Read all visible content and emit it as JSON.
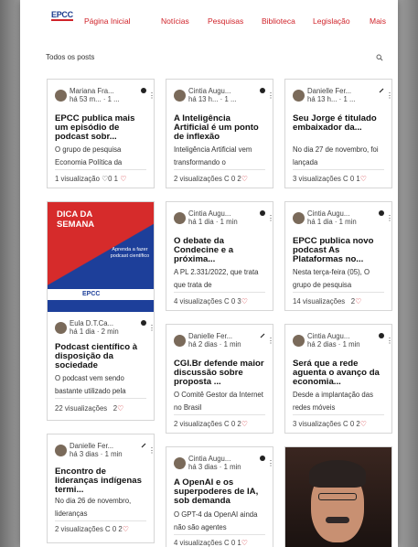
{
  "nav": {
    "logo": "EPCC",
    "items": [
      "Página Inicial",
      "Notícias",
      "Pesquisas",
      "Biblioteca",
      "Legislação",
      "Mais"
    ]
  },
  "section_title": "Todos os posts",
  "colors": {
    "accent": "#d0232a",
    "brand_blue": "#1d3d8f"
  },
  "posts": [
    {
      "author": "Mariana Fra...",
      "meta": "há 53 m... · 1 ...",
      "title": "EPCC publica mais um episódio de podcast sobr...",
      "excerpt": "O grupo de pesquisa Economia Política da",
      "views": "1 visualização",
      "comments": "0",
      "likes": "1"
    },
    {
      "author": "Cintia Augu...",
      "meta": "há 13 h... · 1 ...",
      "title": "A Inteligência Artificial é um ponto de inflexão",
      "excerpt": "Inteligência Artificial vem transformando o",
      "views": "2 visualizações",
      "comments": "0",
      "likes": "2"
    },
    {
      "author": "Danielle Fer...",
      "meta": "há 13 h... · 1 ...",
      "title": "Seu Jorge é titulado embaixador da...",
      "excerpt": "No dia 27 de novembro, foi lançada",
      "views": "3 visualizações",
      "comments": "0",
      "likes": "1"
    },
    {
      "promo_big": "DICA DA SEMANA",
      "promo_small": "Aprenda a fazer podcast científico",
      "promo_logo": "EPCC",
      "author": "Eula D.T.Ca...",
      "meta": "há 1 dia · 2 min",
      "title": "Podcast científico à disposição da sociedade",
      "excerpt": "O podcast vem sendo bastante utilizado pela",
      "views": "22 visualizações",
      "comments": "",
      "likes": "2"
    },
    {
      "author": "Cintia Augu...",
      "meta": "há 1 dia · 1 min",
      "title": "O debate da Condecine e a próxima...",
      "excerpt": "A PL 2.331/2022, que trata que trata de",
      "views": "4 visualizações",
      "comments": "0",
      "likes": "3"
    },
    {
      "author": "Cintia Augu...",
      "meta": "há 1 dia · 1 min",
      "title": "EPCC publica novo podcast As Plataformas no...",
      "excerpt": "Nesta terça-feira (05), O grupo de pesquisa",
      "views": "14 visualizações",
      "comments": "",
      "likes": "2"
    },
    {
      "author": "Danielle Fer...",
      "meta": "há 3 dias · 1 min",
      "title": "Encontro de lideranças indígenas termi...",
      "excerpt": "No dia 26 de novembro, lideranças",
      "views": "2 visualizações",
      "comments": "0",
      "likes": "2"
    },
    {
      "author": "Danielle Fer...",
      "meta": "há 2 dias · 1 min",
      "title": "CGI.Br defende maior discussão sobre proposta ...",
      "excerpt": "O Comitê Gestor da Internet no Brasil",
      "views": "2 visualizações",
      "comments": "0",
      "likes": "2"
    },
    {
      "author": "Cintia Augu...",
      "meta": "há 2 dias · 1 min",
      "title": "Será que a rede aguenta o avanço da economia...",
      "excerpt": "Desde a implantação das redes móveis",
      "views": "3 visualizações",
      "comments": "0",
      "likes": "2"
    },
    {
      "author": "Cintia Augu...",
      "meta": "há 3 dias · 1 min",
      "title": "A OpenAI e os superpoderes de IA, sob demanda",
      "excerpt": "O GPT-4 da OpenAI ainda não são agentes",
      "views": "4 visualizações",
      "comments": "0",
      "likes": "1"
    }
  ]
}
